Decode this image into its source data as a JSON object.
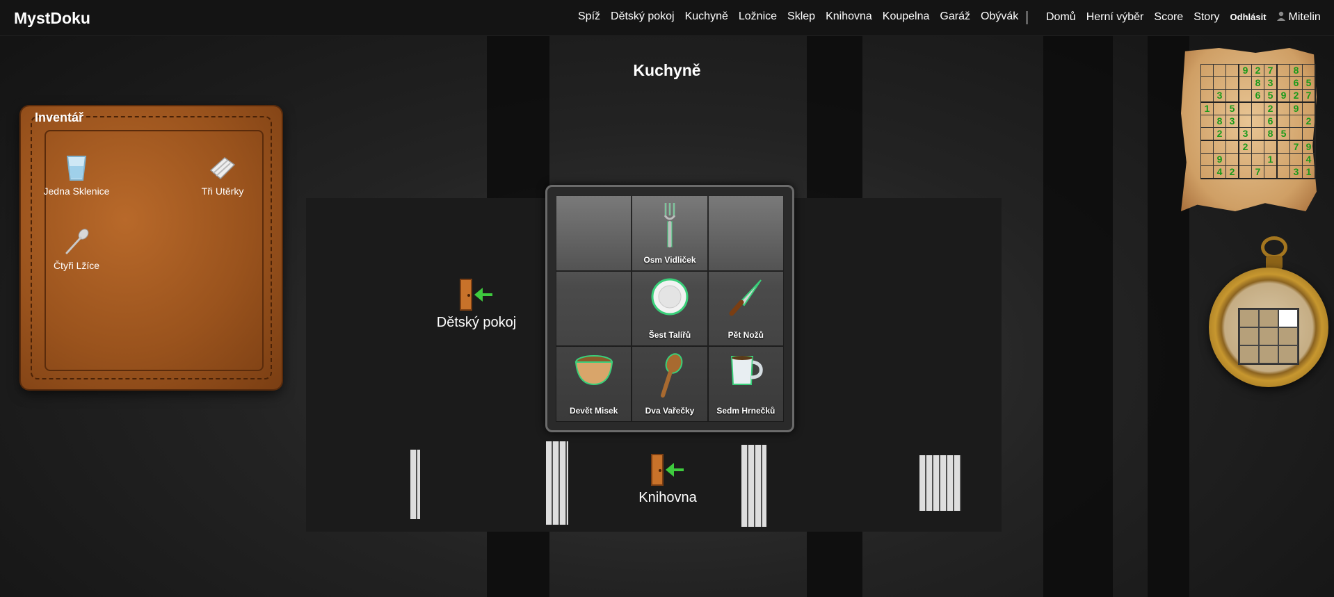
{
  "brand": "MystDoku",
  "nav": {
    "rooms": [
      "Spíž",
      "Dětský pokoj",
      "Kuchyně",
      "Ložnice",
      "Sklep",
      "Knihovna",
      "Koupelna",
      "Garáž",
      "Obývák"
    ],
    "separator": "|",
    "home": "Domů",
    "game_select": "Herní výběr",
    "score": "Score",
    "story": "Story",
    "logout": "Odhlásit",
    "user": "Mitelin"
  },
  "room_title": "Kuchyně",
  "inventory": {
    "title": "Inventář",
    "items": [
      {
        "label": "Jedna Sklenice",
        "icon": "glass-icon"
      },
      {
        "label": "Tři Utěrky",
        "icon": "towel-icon"
      },
      {
        "label": "Čtyři Lžíce",
        "icon": "spoon-icon"
      }
    ]
  },
  "doors": {
    "left": "Dětský pokoj",
    "bottom": "Knihovna"
  },
  "grid_items": [
    {
      "label": "",
      "icon": ""
    },
    {
      "label": "Osm Vidliček",
      "icon": "fork-icon"
    },
    {
      "label": "",
      "icon": ""
    },
    {
      "label": "",
      "icon": ""
    },
    {
      "label": "Šest Talířů",
      "icon": "plate-icon"
    },
    {
      "label": "Pět Nožů",
      "icon": "knife-icon"
    },
    {
      "label": "Devět Misek",
      "icon": "bowl-icon"
    },
    {
      "label": "Dva Vařečky",
      "icon": "wooden-spoon-icon"
    },
    {
      "label": "Sedm Hrnečků",
      "icon": "mug-icon"
    }
  ],
  "sudoku": [
    [
      "",
      "",
      "",
      "9",
      "2",
      "7",
      "",
      "8",
      ""
    ],
    [
      "",
      "",
      "",
      "",
      "8",
      "3",
      "",
      "6",
      "5"
    ],
    [
      "",
      "3",
      "",
      "",
      "6",
      "5",
      "9",
      "2",
      "7"
    ],
    [
      "1",
      "",
      "5",
      "",
      "",
      "2",
      "",
      "9",
      ""
    ],
    [
      "",
      "8",
      "3",
      "",
      "",
      "6",
      "",
      "",
      "2"
    ],
    [
      "",
      "2",
      "",
      "3",
      "",
      "8",
      "5",
      "",
      ""
    ],
    [
      "",
      "",
      "",
      "2",
      "",
      "",
      "",
      "7",
      "9"
    ],
    [
      "",
      "9",
      "",
      "",
      "",
      "1",
      "",
      "",
      "4"
    ],
    [
      "",
      "4",
      "2",
      "",
      "7",
      "",
      "",
      "3",
      "1"
    ]
  ],
  "watch_grid_active": [
    false,
    false,
    true,
    false,
    false,
    false,
    false,
    false,
    false
  ],
  "colors": {
    "accent_green": "#1a9a1a",
    "navbar": "#141414",
    "leather": "#9a531d"
  }
}
